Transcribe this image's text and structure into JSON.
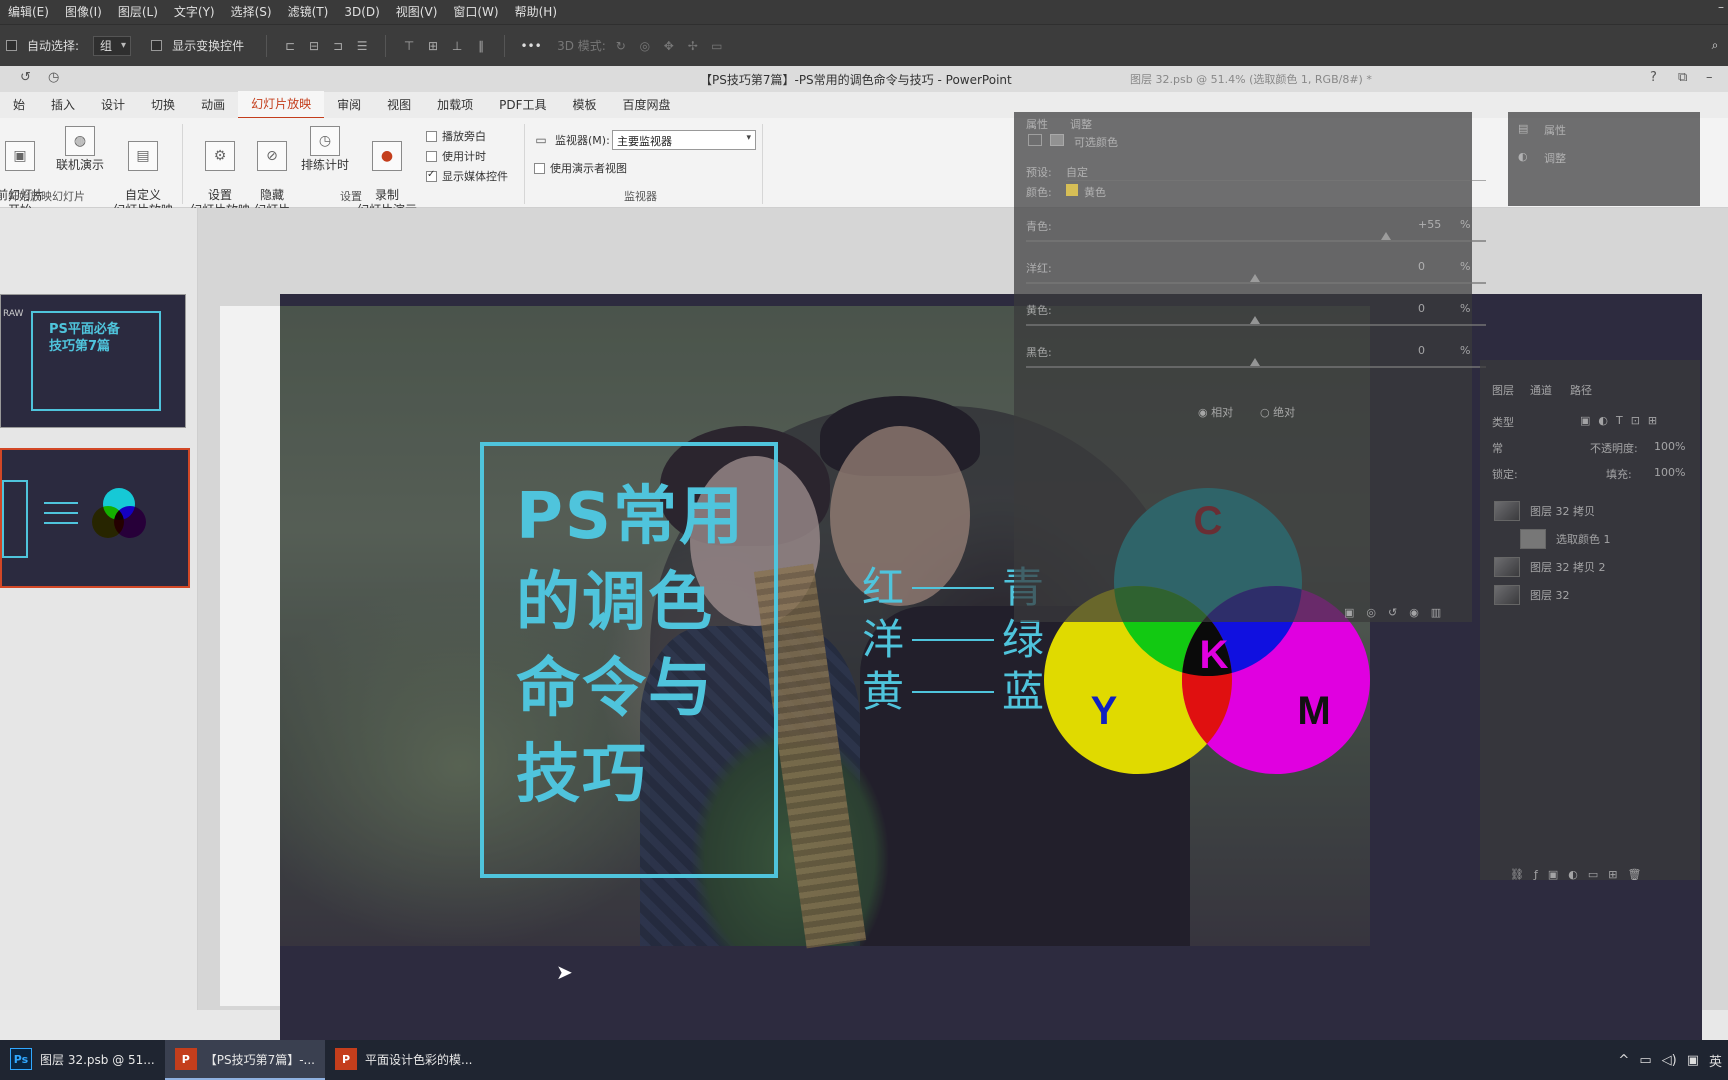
{
  "ps_menu": [
    "编辑(E)",
    "图像(I)",
    "图层(L)",
    "文字(Y)",
    "选择(S)",
    "滤镜(T)",
    "3D(D)",
    "视图(V)",
    "窗口(W)",
    "帮助(H)"
  ],
  "ps_options": {
    "auto_select_label": "自动选择:",
    "auto_select_value": "组",
    "show_transform_label": "显示变换控件",
    "more_label": "•••",
    "mode_3d_label": "3D 模式:"
  },
  "ppt": {
    "window_title": "【PS技巧第7篇】-PS常用的调色命令与技巧 - PowerPoint",
    "ps_doc_tab": "图层 32.psb @ 51.4% (选取颜色 1, RGB/8#) *",
    "tabs": [
      "始",
      "插入",
      "设计",
      "切换",
      "动画",
      "幻灯片放映",
      "审阅",
      "视图",
      "加载项",
      "PDF工具",
      "模板",
      "百度网盘"
    ],
    "active_tab": "幻灯片放映",
    "ribbon": {
      "from_current": "前幻灯片\n开始",
      "online": "联机演示",
      "custom": "自定义\n幻灯片放映",
      "setup": "设置\n幻灯片放映",
      "hide": "隐藏\n幻灯片",
      "rehearse": "排练计时",
      "record": "录制\n幻灯片演示",
      "play_narration": "播放旁白",
      "use_timings": "使用计时",
      "show_media": "显示媒体控件",
      "monitor_label": "监视器(M):",
      "monitor_value": "主要监视器",
      "presenter_view": "使用演示者视图",
      "group_start": "开始放映幻灯片",
      "group_setup": "设置",
      "group_monitor": "监视器"
    }
  },
  "thumbs": {
    "slide1_title": "PS平面必备\n技巧第7篇",
    "slide1_raw": "RAW"
  },
  "slide": {
    "title": "PS常用\n的调色\n命令与\n技巧",
    "pairs": [
      {
        "left": "红",
        "right": "青"
      },
      {
        "left": "洋",
        "right": "绿"
      },
      {
        "left": "黄",
        "right": "蓝"
      }
    ],
    "cmyk": {
      "c": "C",
      "m": "M",
      "y": "Y",
      "k": "K"
    }
  },
  "ps_panel": {
    "properties_tab": "属性",
    "adjust_tab": "调整",
    "selective_color": "可选颜色",
    "preset_label": "预设:",
    "preset_value": "自定",
    "colors_label": "颜色:",
    "colors_value": "黄色",
    "cyan_label": "青色:",
    "cyan_value": "+55",
    "magenta_label": "洋红:",
    "magenta_value": "0",
    "yellow_label": "黄色:",
    "yellow_value": "0",
    "black_label": "黑色:",
    "black_value": "0",
    "percent": "%",
    "relative": "相对",
    "absolute": "绝对",
    "side_properties": "属性",
    "side_adjust": "调整",
    "layers_tabs": [
      "图层",
      "通道",
      "路径"
    ],
    "blend_mode": "常",
    "opacity_label": "不透明度:",
    "opacity_value": "100%",
    "fill_label": "填充:",
    "fill_value": "100%",
    "lock_label": "锁定:",
    "kind_label": "类型",
    "layers": [
      "图层 32 拷贝",
      "选取颜色 1",
      "图层 32 拷贝 2",
      "图层 32"
    ]
  },
  "taskbar": {
    "items": [
      {
        "label": "图层 32.psb @ 51...",
        "icon": "Ps"
      },
      {
        "label": "【PS技巧第7篇】-...",
        "icon": "P"
      },
      {
        "label": "平面设计色彩的模...",
        "icon": "P"
      }
    ],
    "ime": "英"
  }
}
